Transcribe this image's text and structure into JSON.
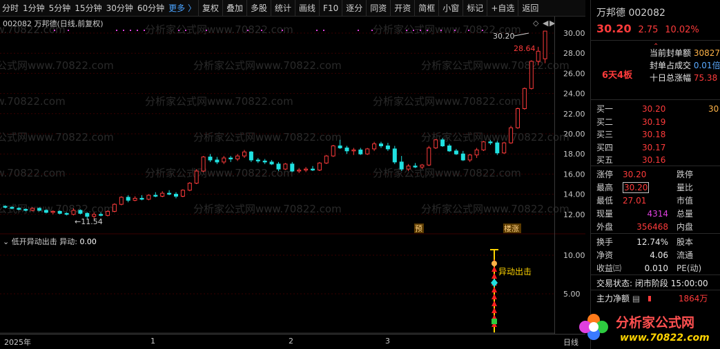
{
  "toolbar": {
    "periods": [
      "分时",
      "1分钟",
      "5分钟",
      "15分钟",
      "30分钟",
      "60分钟"
    ],
    "more": "更多 〉",
    "buttons": [
      "复权",
      "叠加",
      "多股",
      "统计",
      "画线",
      "F10",
      "逐分",
      "同资",
      "开资",
      "简框",
      "小窗",
      "标记",
      "+自选",
      "返回"
    ]
  },
  "chart": {
    "title": "002082 万邦德(日线,前复权)",
    "watermark": "分析家公式网www.70822.com",
    "high_label": "30.20",
    "high_label2": "28.64",
    "low_label": "11.54",
    "marker_yu": "预",
    "marker_board": "楼涨",
    "y_ticks": [
      "30.00",
      "28.00",
      "26.00",
      "24.00",
      "22.00",
      "20.00",
      "18.00",
      "16.00",
      "14.00",
      "12.00"
    ]
  },
  "indicator": {
    "name": "低开异动出击",
    "label": "异动:",
    "value": "0.00",
    "signal_text": "异动出击",
    "y_ticks": [
      "10.00",
      "5.00"
    ]
  },
  "xaxis": {
    "labels": [
      "2025年",
      "1",
      "2",
      "3"
    ],
    "right_label": "日线"
  },
  "panel": {
    "name": "万邦德",
    "code": "002082",
    "price": "30.20",
    "change": "2.75",
    "change_pct": "10.02%",
    "streak": "6天4板",
    "seal_amount_label": "当前封单额",
    "seal_amount": "30827",
    "seal_ratio_label": "封单占成交",
    "seal_ratio": "0.01倍",
    "ten_day_label": "十日总涨幅",
    "ten_day": "75.38",
    "bids": [
      {
        "label": "买一",
        "price": "30.20",
        "vol": "30"
      },
      {
        "label": "买二",
        "price": "30.19",
        "vol": ""
      },
      {
        "label": "买三",
        "price": "30.18",
        "vol": ""
      },
      {
        "label": "买四",
        "price": "30.17",
        "vol": ""
      },
      {
        "label": "买五",
        "price": "30.16",
        "vol": ""
      }
    ],
    "limit_up_label": "涨停",
    "limit_up": "30.20",
    "limit_down_label": "跌停",
    "high_label": "最高",
    "high": "30.20",
    "vol_ratio_label": "量比",
    "low_label": "最低",
    "low": "27.01",
    "mkt_val_label": "市值",
    "now_vol_label": "现量",
    "now_vol": "4314",
    "total_vol_label": "总量",
    "outer_label": "外盘",
    "outer": "356468",
    "inner_label": "内盘",
    "turnover_label": "换手",
    "turnover": "12.74%",
    "capital_label": "股本",
    "net_asset_label": "净资",
    "net_asset": "4.06",
    "float_label": "流通",
    "eps_label": "收益㈢",
    "eps": "0.010",
    "pe_label": "PE(动)",
    "status_label": "交易状态:",
    "status": "闭市阶段",
    "status_time": "15:00:00",
    "main_flow_label": "主力净额",
    "main_flow": "1864万",
    "logo_text": "分析家公式网",
    "logo_url": "www.70822.com"
  },
  "colors": {
    "up": "#ff3b3b",
    "down": "#20e0e0",
    "signal": "#ff2020",
    "grid": "#3a0000"
  }
}
